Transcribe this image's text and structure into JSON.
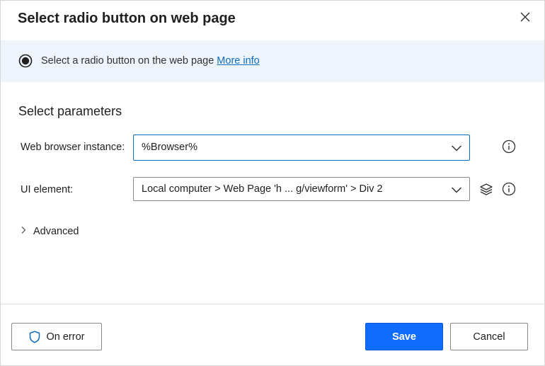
{
  "dialog": {
    "title": "Select radio button on web page",
    "close_icon": "close-icon"
  },
  "info": {
    "text": "Select a radio button on the web page",
    "link": "More info",
    "icon": "radio-button-icon"
  },
  "parameters": {
    "section_title": "Select parameters",
    "browser": {
      "label": "Web browser instance:",
      "value": "%Browser%",
      "info_icon": "info-icon"
    },
    "ui_element": {
      "label": "UI element:",
      "value": "Local computer > Web Page 'h ... g/viewform' > Div 2",
      "layers_icon": "layers-icon",
      "info_icon": "info-icon"
    },
    "advanced": {
      "label": "Advanced",
      "icon": "chevron-right-icon"
    }
  },
  "footer": {
    "on_error_label": "On error",
    "on_error_icon": "shield-icon",
    "save_label": "Save",
    "cancel_label": "Cancel"
  },
  "colors": {
    "accent": "#0f6cff",
    "link": "#0f6cbd",
    "info_band": "#eef4fb"
  }
}
